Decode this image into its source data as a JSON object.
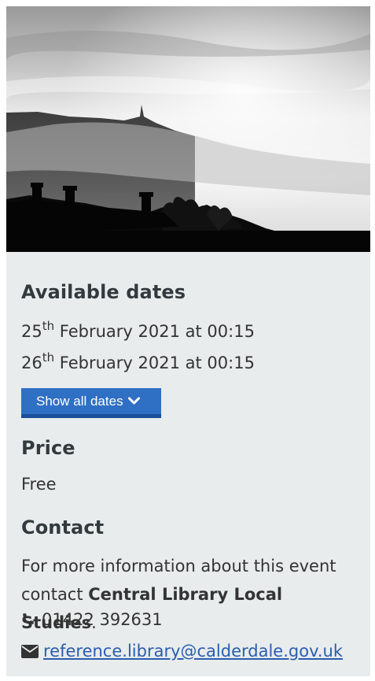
{
  "hero": {
    "alt": "Misty hillside silhouette with chimneys"
  },
  "dates": {
    "heading": "Available dates",
    "items": [
      {
        "day": "25",
        "suffix": "th",
        "rest": " February 2021 at 00:15"
      },
      {
        "day": "26",
        "suffix": "th",
        "rest": " February 2021 at 00:15"
      }
    ],
    "show_all_label": "Show all dates"
  },
  "price": {
    "heading": "Price",
    "value": "Free"
  },
  "contact": {
    "heading": "Contact",
    "text_before": "For more information about this event contact ",
    "org_name": "Central Library Local Studies",
    "text_after": ".",
    "phone": "01422 392631",
    "email": "reference.library@calderdale.gov.uk"
  },
  "colors": {
    "card_background": "#e8ecec",
    "button": "#2f6fc4",
    "button_border": "#1c4f9a",
    "link": "#2a5db0"
  },
  "icons": {
    "button": "chevron-down-icon",
    "phone": "phone-icon",
    "email": "envelope-icon"
  }
}
